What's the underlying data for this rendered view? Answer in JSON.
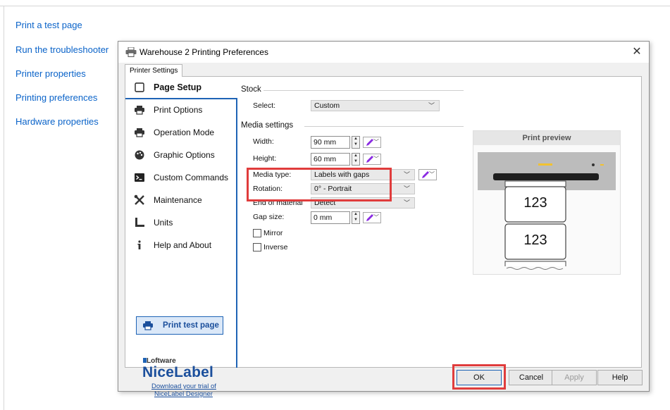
{
  "side_links": [
    "Print a test page",
    "Run the troubleshooter",
    "Printer properties",
    "Printing preferences",
    "Hardware properties"
  ],
  "dialog": {
    "title": "Warehouse 2 Printing Preferences",
    "close_glyph": "✕",
    "tab": "Printer Settings"
  },
  "nav": {
    "items": [
      {
        "label": "Page Setup",
        "icon": "page-icon"
      },
      {
        "label": "Print Options",
        "icon": "printer-icon"
      },
      {
        "label": "Operation Mode",
        "icon": "printer-icon"
      },
      {
        "label": "Graphic Options",
        "icon": "palette-icon"
      },
      {
        "label": "Custom Commands",
        "icon": "terminal-icon"
      },
      {
        "label": "Maintenance",
        "icon": "tools-icon"
      },
      {
        "label": "Units",
        "icon": "ruler-icon"
      },
      {
        "label": "Help and About",
        "icon": "info-icon"
      }
    ],
    "active_index": 0,
    "print_test_label": "Print test page",
    "brand_small": "Loftware",
    "brand_big": "NiceLabel",
    "brand_link_1": "Download your trial of",
    "brand_link_2": "NiceLabel Designer"
  },
  "stock": {
    "title": "Stock",
    "select_label": "Select:",
    "select_value": "Custom"
  },
  "media": {
    "title": "Media settings",
    "width_label": "Width:",
    "width_value": "90 mm",
    "height_label": "Height:",
    "height_value": "60 mm",
    "media_type_label": "Media type:",
    "media_type_value": "Labels with gaps",
    "rotation_label": "Rotation:",
    "rotation_value": "0° - Portrait",
    "end_label": "End of material",
    "end_value": "Detect",
    "gap_label": "Gap size:",
    "gap_value": "0 mm",
    "mirror_label": "Mirror",
    "inverse_label": "Inverse"
  },
  "preview": {
    "title": "Print preview",
    "label_1": "123",
    "label_2": "123"
  },
  "buttons": {
    "ok": "OK",
    "cancel": "Cancel",
    "apply": "Apply",
    "help": "Help"
  },
  "colors": {
    "link": "#0a63c9",
    "accent": "#1e63b5",
    "highlight": "#e03c3c",
    "pen": "#8a2be2"
  }
}
